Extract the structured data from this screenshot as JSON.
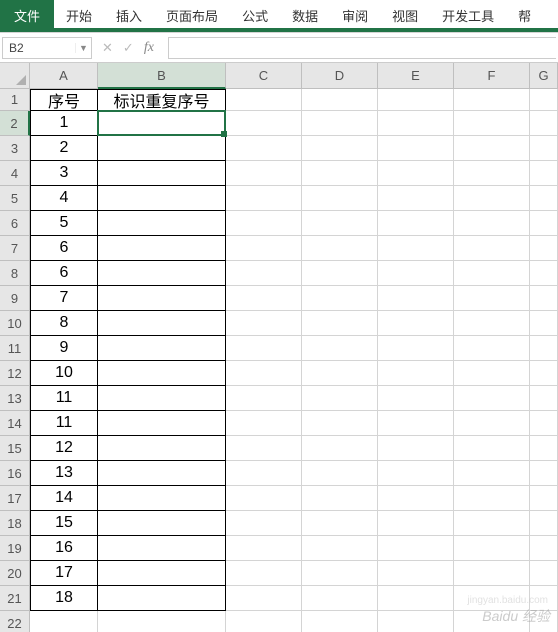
{
  "ribbon": {
    "tabs": [
      "文件",
      "开始",
      "插入",
      "页面布局",
      "公式",
      "数据",
      "审阅",
      "视图",
      "开发工具",
      "帮"
    ]
  },
  "formula_bar": {
    "name_box": "B2",
    "cancel": "✕",
    "confirm": "✓",
    "fx": "fx",
    "formula": ""
  },
  "grid": {
    "col_widths": {
      "A": 68,
      "B": 128,
      "C": 76,
      "D": 76,
      "E": 76,
      "F": 76,
      "G": 28
    },
    "row_header_height": 22,
    "row_data_height": 25,
    "columns": [
      "A",
      "B",
      "C",
      "D",
      "E",
      "F",
      "G"
    ],
    "active_cell": {
      "row": 2,
      "col": "B"
    },
    "rows": [
      {
        "r": 1,
        "A": "序号",
        "B": "标识重复序号"
      },
      {
        "r": 2,
        "A": "1",
        "B": ""
      },
      {
        "r": 3,
        "A": "2",
        "B": ""
      },
      {
        "r": 4,
        "A": "3",
        "B": ""
      },
      {
        "r": 5,
        "A": "4",
        "B": ""
      },
      {
        "r": 6,
        "A": "5",
        "B": ""
      },
      {
        "r": 7,
        "A": "6",
        "B": ""
      },
      {
        "r": 8,
        "A": "6",
        "B": ""
      },
      {
        "r": 9,
        "A": "7",
        "B": ""
      },
      {
        "r": 10,
        "A": "8",
        "B": ""
      },
      {
        "r": 11,
        "A": "9",
        "B": ""
      },
      {
        "r": 12,
        "A": "10",
        "B": ""
      },
      {
        "r": 13,
        "A": "11",
        "B": ""
      },
      {
        "r": 14,
        "A": "11",
        "B": ""
      },
      {
        "r": 15,
        "A": "12",
        "B": ""
      },
      {
        "r": 16,
        "A": "13",
        "B": ""
      },
      {
        "r": 17,
        "A": "14",
        "B": ""
      },
      {
        "r": 18,
        "A": "15",
        "B": ""
      },
      {
        "r": 19,
        "A": "16",
        "B": ""
      },
      {
        "r": 20,
        "A": "17",
        "B": ""
      },
      {
        "r": 21,
        "A": "18",
        "B": ""
      },
      {
        "r": 22,
        "A": "",
        "B": ""
      }
    ],
    "data_last_row": 21
  },
  "watermark": {
    "main": "Baidu 经验",
    "sub": "jingyan.baidu.com"
  }
}
